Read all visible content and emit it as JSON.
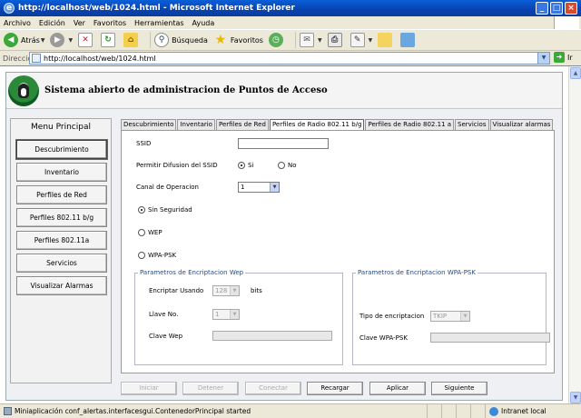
{
  "window": {
    "title": "http://localhost/web/1024.html - Microsoft Internet Explorer"
  },
  "menu": [
    "Archivo",
    "Edición",
    "Ver",
    "Favoritos",
    "Herramientas",
    "Ayuda"
  ],
  "toolbar": {
    "back_label": "Atrás",
    "search_label": "Búsqueda",
    "favorites_label": "Favoritos"
  },
  "address": {
    "label": "Dirección",
    "url": "http://localhost/web/1024.html",
    "go_label": "Ir"
  },
  "app": {
    "title": "Sistema abierto de administracion de Puntos de Acceso",
    "menu_title": "Menu Principal",
    "menu_items": [
      "Descubrimiento",
      "Inventario",
      "Perfiles de Red",
      "Perfiles 802.11 b/g",
      "Perfiles 802.11a",
      "Servicios",
      "Visualizar Alarmas"
    ],
    "tabs": [
      "Descubrimiento",
      "Inventario",
      "Perfiles de Red",
      "Perfiles de Radio 802.11 b/g",
      "Perfiles de Radio 802.11 a",
      "Servicios",
      "Visualizar alarmas"
    ],
    "active_tab": 3,
    "form": {
      "ssid_label": "SSID",
      "ssid_value": "",
      "difusion_label": "Permitir Difusion del SSID",
      "si_label": "Si",
      "no_label": "No",
      "canal_label": "Canal de Operacion",
      "canal_value": "1",
      "sin_seguridad_label": "Sin Seguridad",
      "wep_label": "WEP",
      "wpa_label": "WPA-PSK",
      "wep_group_title": "Parametros de Encriptacion Wep",
      "encriptar_label": "Encriptar Usando",
      "encriptar_value": "128",
      "bits_label": "bits",
      "llave_label": "Llave No.",
      "llave_value": "1",
      "clave_wep_label": "Clave Wep",
      "wpa_group_title": "Parametros de Encriptacion WPA-PSK",
      "tipo_label": "Tipo de encriptacion",
      "tipo_value": "TKIP",
      "clave_wpa_label": "Clave WPA-PSK"
    },
    "buttons": {
      "iniciar": "Iniciar",
      "detener": "Detener",
      "conectar": "Conectar",
      "recargar": "Recargar",
      "aplicar": "Aplicar",
      "siguiente": "Siguiente"
    }
  },
  "status": {
    "text": "Miniaplicación conf_alertas.interfacesgui.ContenedorPrincipal started",
    "zone": "Intranet local"
  }
}
